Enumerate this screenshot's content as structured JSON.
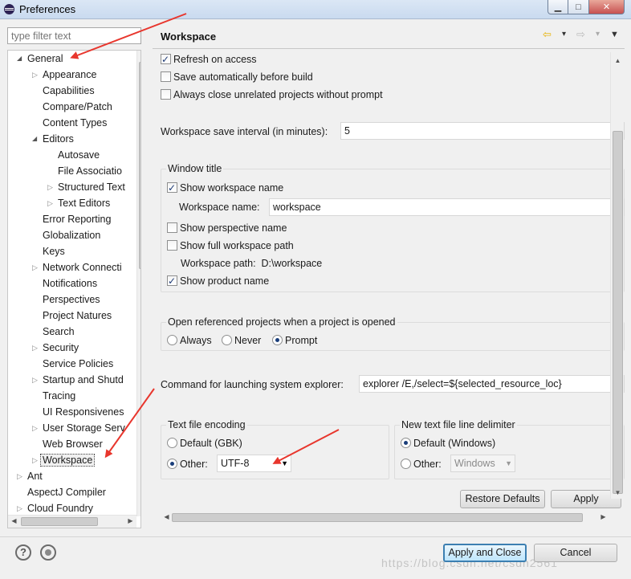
{
  "window": {
    "title": "Preferences",
    "min_glyph": "▁",
    "max_glyph": "□",
    "close_glyph": "✕"
  },
  "filter": {
    "placeholder": "type filter text"
  },
  "tree": [
    {
      "label": "General",
      "level": 0,
      "arrow": "expanded"
    },
    {
      "label": "Appearance",
      "level": 1,
      "arrow": "collapsed"
    },
    {
      "label": "Capabilities",
      "level": 1,
      "arrow": "none"
    },
    {
      "label": "Compare/Patch",
      "level": 1,
      "arrow": "none"
    },
    {
      "label": "Content Types",
      "level": 1,
      "arrow": "none"
    },
    {
      "label": "Editors",
      "level": 1,
      "arrow": "expanded"
    },
    {
      "label": "Autosave",
      "level": 2,
      "arrow": "none"
    },
    {
      "label": "File Associatio",
      "level": 2,
      "arrow": "none"
    },
    {
      "label": "Structured Text",
      "level": 2,
      "arrow": "collapsed"
    },
    {
      "label": "Text Editors",
      "level": 2,
      "arrow": "collapsed"
    },
    {
      "label": "Error Reporting",
      "level": 1,
      "arrow": "none"
    },
    {
      "label": "Globalization",
      "level": 1,
      "arrow": "none"
    },
    {
      "label": "Keys",
      "level": 1,
      "arrow": "none"
    },
    {
      "label": "Network Connecti",
      "level": 1,
      "arrow": "collapsed"
    },
    {
      "label": "Notifications",
      "level": 1,
      "arrow": "none"
    },
    {
      "label": "Perspectives",
      "level": 1,
      "arrow": "none"
    },
    {
      "label": "Project Natures",
      "level": 1,
      "arrow": "none"
    },
    {
      "label": "Search",
      "level": 1,
      "arrow": "none"
    },
    {
      "label": "Security",
      "level": 1,
      "arrow": "collapsed"
    },
    {
      "label": "Service Policies",
      "level": 1,
      "arrow": "none"
    },
    {
      "label": "Startup and Shutd",
      "level": 1,
      "arrow": "collapsed"
    },
    {
      "label": "Tracing",
      "level": 1,
      "arrow": "none"
    },
    {
      "label": "UI Responsivenes",
      "level": 1,
      "arrow": "none"
    },
    {
      "label": "User Storage Serv",
      "level": 1,
      "arrow": "collapsed"
    },
    {
      "label": "Web Browser",
      "level": 1,
      "arrow": "none"
    },
    {
      "label": "Workspace",
      "level": 1,
      "arrow": "collapsed",
      "selected": true
    },
    {
      "label": "Ant",
      "level": 0,
      "arrow": "collapsed"
    },
    {
      "label": "AspectJ Compiler",
      "level": 0,
      "arrow": "none"
    },
    {
      "label": "Cloud Foundry",
      "level": 0,
      "arrow": "collapsed"
    }
  ],
  "page": {
    "title": "Workspace",
    "refresh_on_access": "Refresh on access",
    "save_automatically": "Save automatically before build",
    "always_close": "Always close unrelated projects without prompt",
    "save_interval_label": "Workspace save interval (in minutes):",
    "save_interval_value": "5",
    "window_title_group": "Window title",
    "show_workspace_name": "Show workspace name",
    "workspace_name_label": "Workspace name:",
    "workspace_name_value": "workspace",
    "show_perspective_name": "Show perspective name",
    "show_full_path": "Show full workspace path",
    "workspace_path_label": "Workspace path:",
    "workspace_path_value": "D:\\workspace",
    "show_product_name": "Show product name",
    "open_referenced_group": "Open referenced projects when a project is opened",
    "opt_always": "Always",
    "opt_never": "Never",
    "opt_prompt": "Prompt",
    "explorer_label": "Command for launching system explorer:",
    "explorer_value": "explorer /E,/select=${selected_resource_loc}",
    "encoding_group": "Text file encoding",
    "encoding_default": "Default (GBK)",
    "encoding_other": "Other:",
    "encoding_value": "UTF-8",
    "delimiter_group": "New text file line delimiter",
    "delimiter_default": "Default (Windows)",
    "delimiter_other": "Other:",
    "delimiter_value": "Windows",
    "restore_defaults": "Restore Defaults",
    "apply": "Apply"
  },
  "states": {
    "refresh_on_access": true,
    "save_automatically": false,
    "always_close": false,
    "show_workspace_name": true,
    "show_perspective_name": false,
    "show_full_path": false,
    "show_product_name": true,
    "open_referenced": "Prompt",
    "encoding": "Other",
    "delimiter": "Default"
  },
  "footer": {
    "help_glyph": "?",
    "apply_and_close": "Apply and Close",
    "cancel": "Cancel"
  },
  "watermark": "https://blog.csdn.net/csdn2561",
  "icons": {
    "back": "⇦",
    "forward": "⇨",
    "dropdown": "▾",
    "menu": "▼"
  },
  "colors": {
    "annotation_arrow": "#e8362d",
    "default_button_border": "#3c7fb1",
    "check_mark": "#1f3c77"
  }
}
